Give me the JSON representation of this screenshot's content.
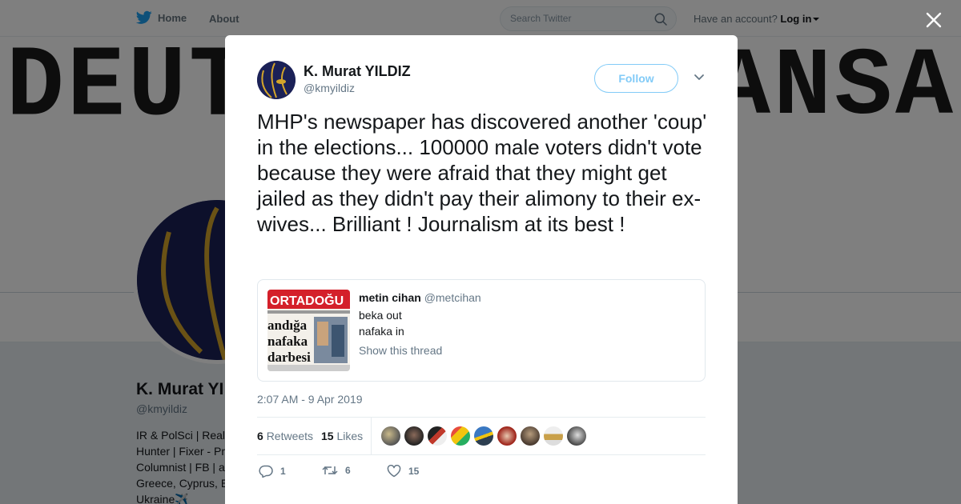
{
  "topbar": {
    "home_label": "Home",
    "about_label": "About",
    "search_placeholder": "Search Twitter",
    "account_prompt": "Have an account?",
    "login_label": "Log in"
  },
  "background_profile": {
    "banner_text_left": "DEUT",
    "banner_text_right": "ANSA",
    "name": "K. Murat YI",
    "handle": "@kmyildiz",
    "bio_lines": [
      "IR & PolSci | Real",
      "Hunter | Fixer - Pr",
      "Columnist | FB | a",
      "Greece, Cyprus, E",
      "Ukraine✈️"
    ]
  },
  "tweet": {
    "author_name": "K. Murat YILDIZ",
    "author_handle": "@kmyildiz",
    "follow_label": "Follow",
    "text": "MHP's newspaper has discovered another 'coup' in the elections... 100000 male voters didn't vote because they were afraid that they might get jailed as they didn't pay their alimony to their ex-wives... Brilliant ! Journalism at its best !",
    "quote": {
      "author_name": "metin cihan",
      "author_handle": "@metcihan",
      "line1": "beka out",
      "line2": "nafaka in",
      "thread_label": "Show this thread",
      "thumb_masthead": "ORTADOĞU",
      "thumb_headline_1": "andığa",
      "thumb_headline_2": "nafaka",
      "thumb_headline_3": "darbesi"
    },
    "timestamp": "2:07 AM - 9 Apr 2019",
    "retweets_count": "6",
    "retweets_label": "Retweets",
    "likes_count": "15",
    "likes_label": "Likes",
    "actions": {
      "reply_count": "1",
      "retweet_count": "6",
      "like_count": "15"
    }
  },
  "colors": {
    "accent": "#1da1f2",
    "overlay": "rgba(0,0,0,0.5)",
    "avatar_navy": "#1b2157",
    "avatar_gold": "#d4a52a"
  }
}
